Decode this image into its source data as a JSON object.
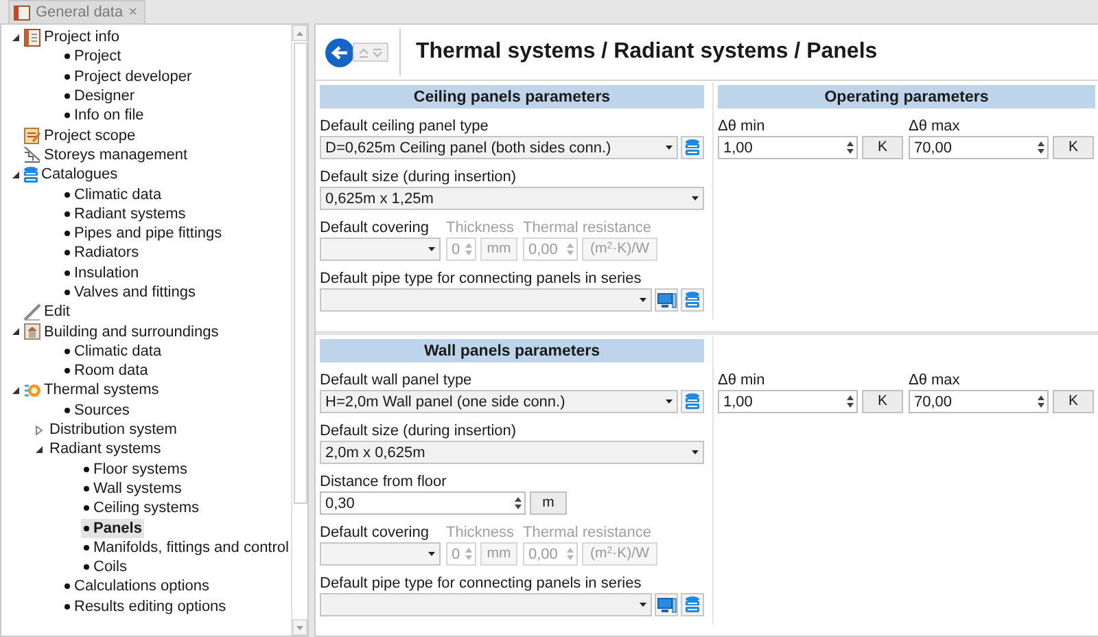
{
  "tab": {
    "title": "General data",
    "close": "×"
  },
  "tree": [
    {
      "kind": "section",
      "label": "Project info",
      "expanded": true,
      "selected": false,
      "children": [
        {
          "kind": "bullet",
          "label": "Project",
          "selected": false
        },
        {
          "kind": "bullet",
          "label": "Project developer",
          "selected": false
        },
        {
          "kind": "bullet",
          "label": "Designer",
          "selected": false
        },
        {
          "kind": "bullet",
          "label": "Info on file",
          "selected": false
        }
      ]
    },
    {
      "kind": "page",
      "label": "Project scope",
      "selected": false
    },
    {
      "kind": "page",
      "label": "Storeys management",
      "selected": false
    },
    {
      "kind": "section",
      "label": "Catalogues",
      "expanded": true,
      "selected": false,
      "children": [
        {
          "kind": "bullet",
          "label": "Climatic data",
          "selected": false
        },
        {
          "kind": "bullet",
          "label": "Radiant systems",
          "selected": false
        },
        {
          "kind": "bullet",
          "label": "Pipes and pipe fittings",
          "selected": false
        },
        {
          "kind": "bullet",
          "label": "Radiators",
          "selected": false
        },
        {
          "kind": "bullet",
          "label": "Insulation",
          "selected": false
        },
        {
          "kind": "bullet",
          "label": "Valves and fittings",
          "selected": false
        }
      ]
    },
    {
      "kind": "page",
      "label": "Edit",
      "selected": false
    },
    {
      "kind": "section",
      "label": "Building and surroundings",
      "expanded": true,
      "selected": false,
      "children": [
        {
          "kind": "bullet",
          "label": "Climatic data",
          "selected": false
        },
        {
          "kind": "bullet",
          "label": "Room data",
          "selected": false
        }
      ]
    },
    {
      "kind": "section",
      "label": "Thermal systems",
      "expanded": true,
      "selected": false,
      "children": [
        {
          "kind": "bullet",
          "label": "Sources",
          "selected": false
        },
        {
          "kind": "folder",
          "label": "Distribution system",
          "expanded": false,
          "selected": false
        },
        {
          "kind": "folder",
          "label": "Radiant systems",
          "expanded": true,
          "selected": false,
          "children": [
            {
              "kind": "bullet",
              "label": "Floor systems",
              "selected": false
            },
            {
              "kind": "bullet",
              "label": "Wall systems",
              "selected": false
            },
            {
              "kind": "bullet",
              "label": "Ceiling systems",
              "selected": false
            },
            {
              "kind": "bullet",
              "label": "Panels",
              "selected": true
            },
            {
              "kind": "bullet",
              "label": "Manifolds, fittings and control",
              "selected": false
            },
            {
              "kind": "bullet",
              "label": "Coils",
              "selected": false
            }
          ]
        },
        {
          "kind": "bullet",
          "label": "Calculations options",
          "selected": false
        },
        {
          "kind": "bullet",
          "label": "Results editing options",
          "selected": false
        }
      ]
    }
  ],
  "breadcrumb": "Thermal systems / Radiant systems / Panels",
  "sections": [
    {
      "title": "Ceiling panels parameters",
      "fields": [
        {
          "kind": "combo-library",
          "label": "Default ceiling panel type",
          "value": "D=0,625m Ceiling panel (both sides conn.)"
        },
        {
          "kind": "combo",
          "label": "Default size (during insertion)",
          "value": "0,625m x 1,25m"
        },
        {
          "kind": "covering",
          "label": "Default covering",
          "disabled": true,
          "thickness_label": "Thickness",
          "thickness": "0",
          "thickness_unit": "mm",
          "resistance_label": "Thermal resistance",
          "resistance": "0,00",
          "resistance_unit": "(m$^{2}$·K)/W"
        },
        {
          "kind": "combo-pipe",
          "label": "Default pipe type for connecting panels in series"
        }
      ],
      "operating": {
        "title": "Operating parameters",
        "fields": [
          {
            "label": "Δθ min",
            "value": "1,00",
            "unit": "K"
          },
          {
            "label": "Δθ max",
            "value": "70,00",
            "unit": "K"
          }
        ]
      }
    },
    {
      "title": "Wall panels parameters",
      "fields": [
        {
          "kind": "combo-library",
          "label": "Default wall panel type",
          "value": "H=2,0m Wall panel (one side conn.)"
        },
        {
          "kind": "combo",
          "label": "Default size (during insertion)",
          "value": "2,0m x 0,625m"
        },
        {
          "kind": "spin-unit",
          "label": "Distance from floor",
          "value": "0,30",
          "unit": "m"
        },
        {
          "kind": "covering",
          "label": "Default covering",
          "disabled": true,
          "thickness_label": "Thickness",
          "thickness": "0",
          "thickness_unit": "mm",
          "resistance_label": "Thermal resistance",
          "resistance": "0,00",
          "resistance_unit": "(m$^{2}$·K)/W"
        },
        {
          "kind": "combo-pipe",
          "label": "Default pipe type for connecting panels in series"
        }
      ],
      "operating": {
        "fields": [
          {
            "label": "Δθ min",
            "value": "1,00",
            "unit": "K"
          },
          {
            "label": "Δθ max",
            "value": "70,00",
            "unit": "K"
          }
        ]
      }
    }
  ]
}
